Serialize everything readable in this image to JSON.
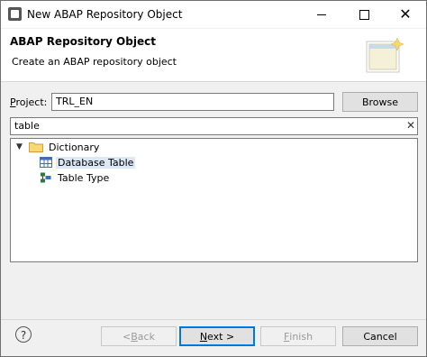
{
  "window": {
    "title": "New ABAP Repository Object"
  },
  "header": {
    "title": "ABAP Repository Object",
    "description": "Create an ABAP repository object"
  },
  "project": {
    "label_prefix": "P",
    "label_rest": "roject:",
    "value": "TRL_EN",
    "browse_label": "Browse"
  },
  "filter": {
    "value": "table"
  },
  "tree": {
    "nodes": [
      {
        "label": "Dictionary",
        "icon": "folder-icon",
        "expanded": true
      },
      {
        "label": "Database Table",
        "icon": "database-table-icon",
        "selected": true
      },
      {
        "label": "Table Type",
        "icon": "table-type-icon"
      }
    ]
  },
  "buttons": {
    "back_prefix": "< ",
    "back_u": "B",
    "back_rest": "ack",
    "next_u": "N",
    "next_rest": "ext >",
    "finish_u": "F",
    "finish_rest": "inish",
    "cancel": "Cancel"
  },
  "colors": {
    "selection": "#dbe8f6",
    "default_button_border": "#0078d7"
  }
}
